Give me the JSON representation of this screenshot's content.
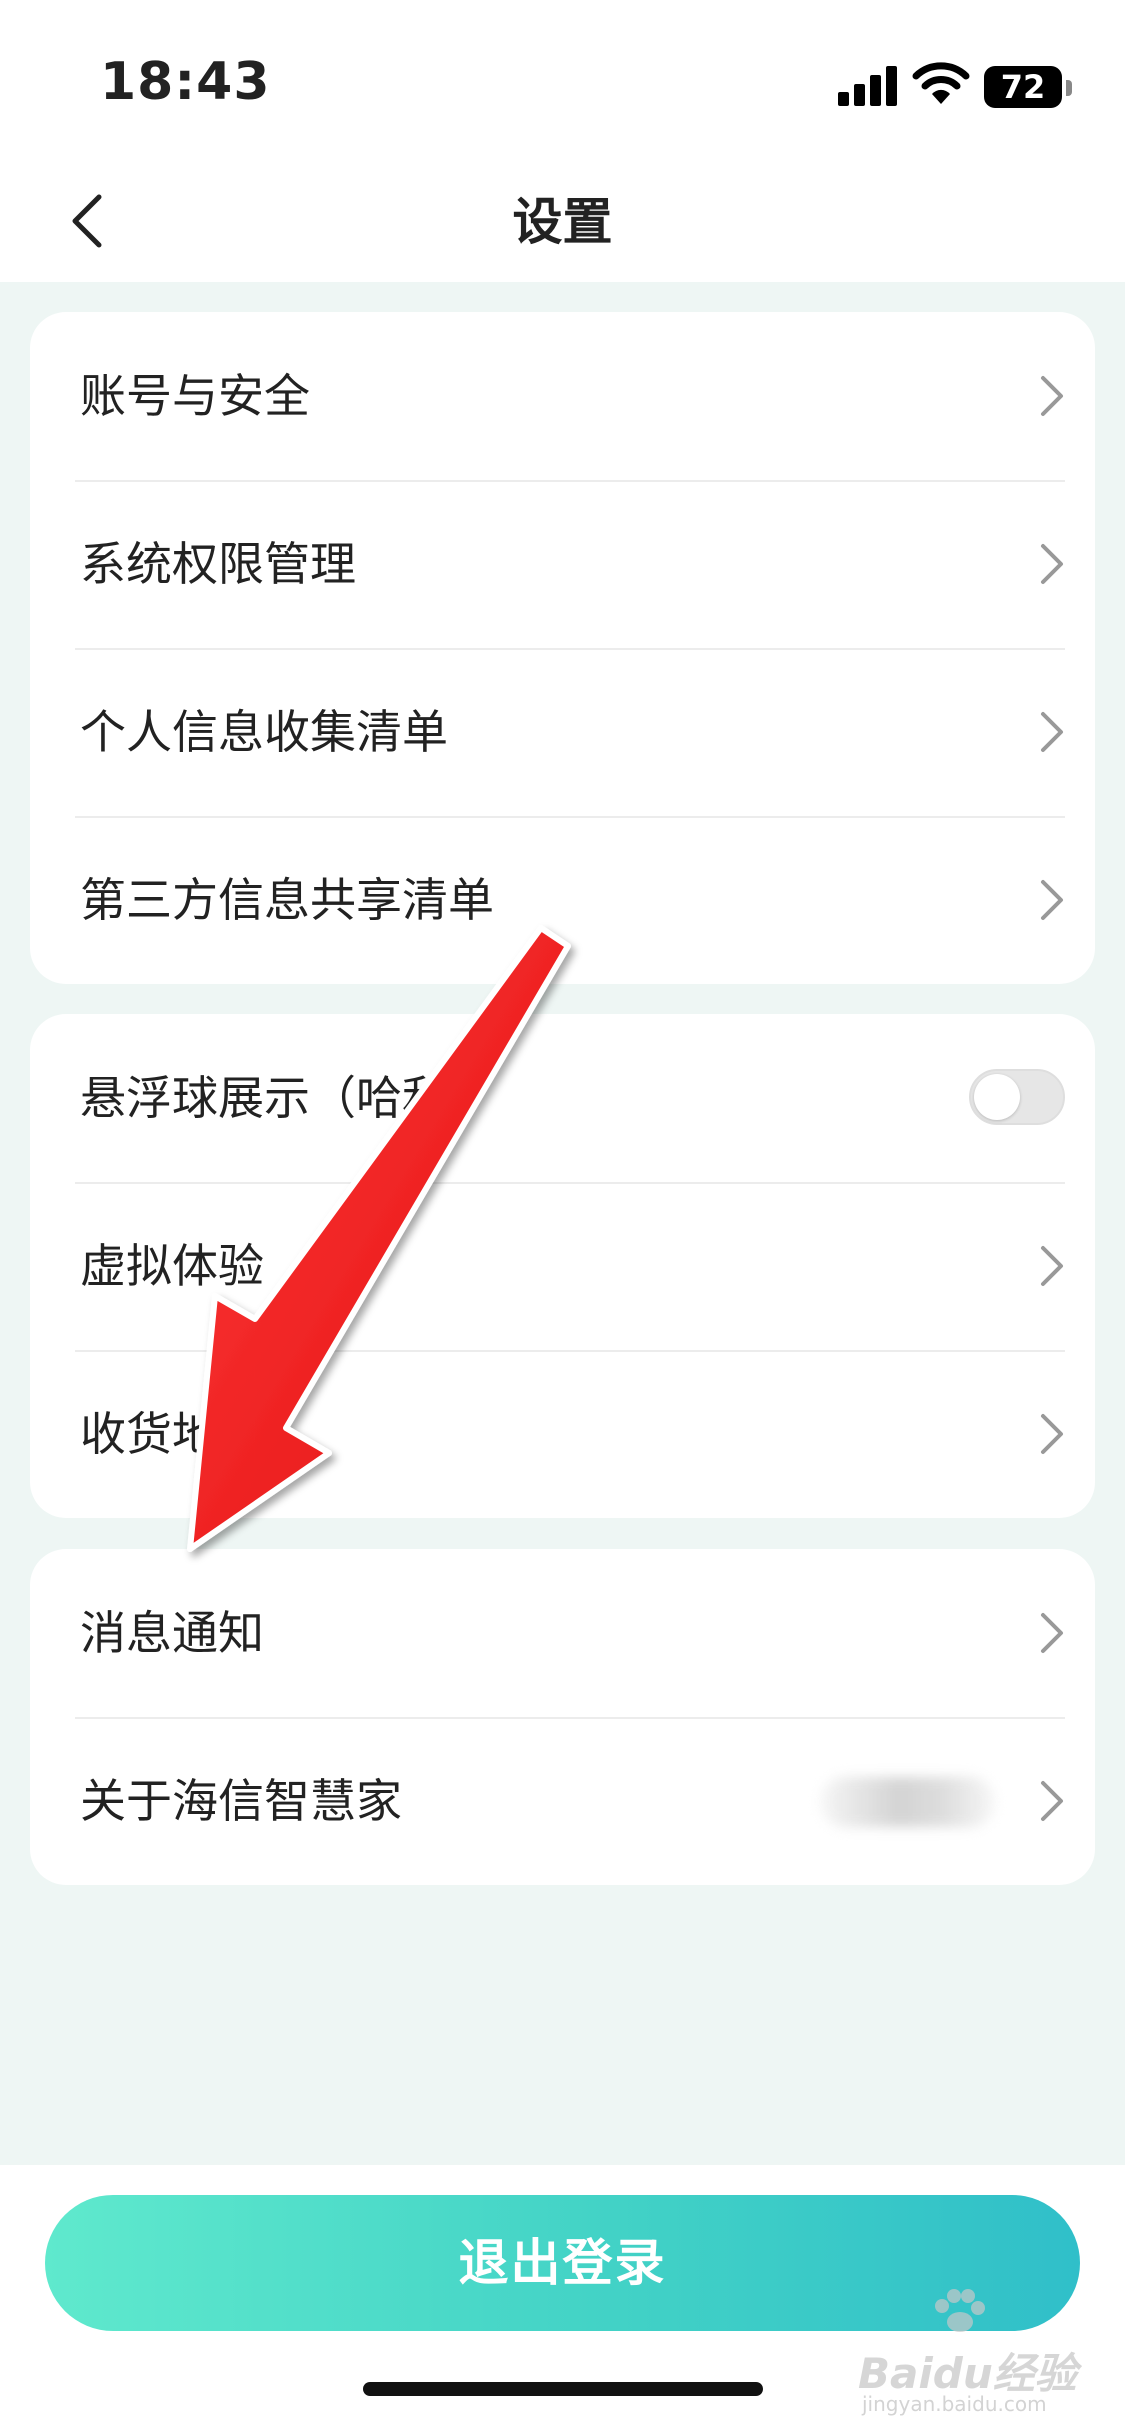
{
  "status_bar": {
    "time": "18:43",
    "battery": "72"
  },
  "navbar": {
    "title": "设置"
  },
  "groups": [
    {
      "items": [
        {
          "label": "账号与安全",
          "control": "chevron"
        },
        {
          "label": "系统权限管理",
          "control": "chevron"
        },
        {
          "label": "个人信息收集清单",
          "control": "chevron"
        },
        {
          "label": "第三方信息共享清单",
          "control": "chevron"
        }
      ]
    },
    {
      "items": [
        {
          "label": "悬浮球展示（哈利）",
          "control": "toggle",
          "toggle_on": false
        },
        {
          "label": "虚拟体验",
          "control": "chevron"
        },
        {
          "label": "收货地址",
          "control": "chevron"
        }
      ]
    },
    {
      "items": [
        {
          "label": "消息通知",
          "control": "chevron"
        },
        {
          "label": "关于海信智慧家",
          "control": "chevron"
        }
      ]
    }
  ],
  "bottom": {
    "logout_label": "退出登录"
  },
  "watermark": {
    "text": "Baidu经验",
    "sub": "jingyan.baidu.com"
  },
  "colors": {
    "accent_start": "#5fe9cd",
    "accent_end": "#30bfc9",
    "annotation_arrow": "#f21d1d",
    "page_background": "#eef6f4"
  }
}
